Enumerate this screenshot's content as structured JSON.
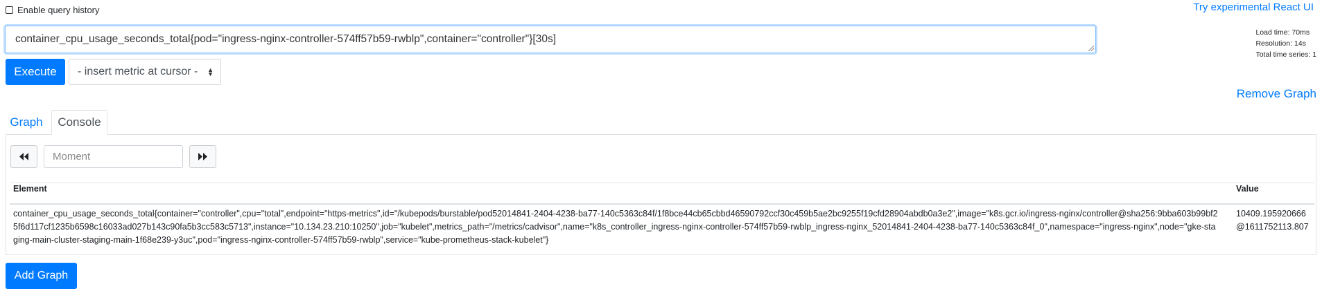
{
  "header": {
    "history_label": "Enable query history",
    "react_link": "Try experimental React UI"
  },
  "query": {
    "expression": "container_cpu_usage_seconds_total{pod=\"ingress-nginx-controller-574ff57b59-rwblp\",container=\"controller\"}[30s]"
  },
  "stats": {
    "load_time": "Load time: 70ms",
    "resolution": "Resolution: 14s",
    "total_series": "Total time series: 1"
  },
  "toolbar": {
    "execute_label": "Execute",
    "metric_select_value": "- insert metric at cursor -"
  },
  "panel": {
    "remove_label": "Remove Graph",
    "tabs": [
      {
        "label": "Graph"
      },
      {
        "label": "Console"
      }
    ],
    "moment_placeholder": "Moment",
    "table": {
      "headers": [
        "Element",
        "Value"
      ],
      "rows": [
        {
          "element": "container_cpu_usage_seconds_total{container=\"controller\",cpu=\"total\",endpoint=\"https-metrics\",id=\"/kubepods/burstable/pod52014841-2404-4238-ba77-140c5363c84f/1f8bce44cb65cbbd46590792ccf30c459b5ae2bc9255f19cfd28904abdb0a3e2\",image=\"k8s.gcr.io/ingress-nginx/controller@sha256:9bba603b99bf25f6d117cf1235b6598c16033ad027b143c90fa5b3cc583c5713\",instance=\"10.134.23.210:10250\",job=\"kubelet\",metrics_path=\"/metrics/cadvisor\",name=\"k8s_controller_ingress-nginx-controller-574ff57b59-rwblp_ingress-nginx_52014841-2404-4238-ba77-140c5363c84f_0\",namespace=\"ingress-nginx\",node=\"gke-staging-main-cluster-staging-main-1f68e239-y3uc\",pod=\"ingress-nginx-controller-574ff57b59-rwblp\",service=\"kube-prometheus-stack-kubelet\"}",
          "value": "10409.195920666 @1611752113.807"
        }
      ]
    }
  },
  "footer": {
    "add_graph_label": "Add Graph"
  },
  "icons": {
    "prev": "backward-icon",
    "next": "forward-icon",
    "select_arrows": "sort-arrows-icon"
  }
}
